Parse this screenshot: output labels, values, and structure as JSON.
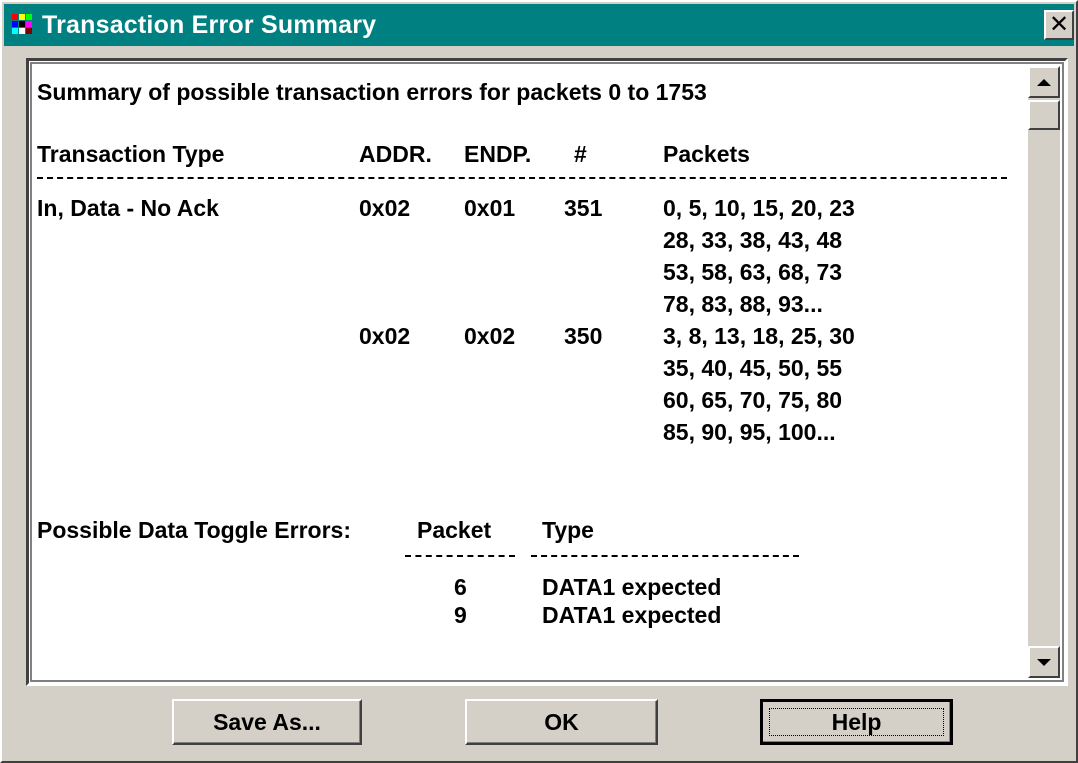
{
  "window": {
    "title": "Transaction Error Summary",
    "close_glyph": "✕"
  },
  "summary": {
    "heading": "Summary of possible transaction errors for packets 0 to 1753",
    "columns": {
      "type": "Transaction Type",
      "addr": "ADDR.",
      "endp": "ENDP.",
      "count": "#",
      "packets": "Packets"
    },
    "rows": [
      {
        "type": "In, Data - No Ack",
        "addr": "0x02",
        "endp": "0x01",
        "count": "351",
        "packets": [
          "0, 5, 10, 15, 20, 23",
          "28, 33, 38, 43, 48",
          "53, 58, 63, 68, 73",
          "78, 83, 88, 93..."
        ]
      },
      {
        "type": "",
        "addr": "0x02",
        "endp": "0x02",
        "count": "350",
        "packets": [
          "3, 8, 13, 18, 25, 30",
          "35, 40, 45, 50, 55",
          "60, 65, 70, 75, 80",
          "85, 90, 95, 100..."
        ]
      }
    ]
  },
  "toggle": {
    "label": "Possible Data Toggle Errors:",
    "col_packet": "Packet",
    "col_type": "Type",
    "rows": [
      {
        "packet": "6",
        "type": "DATA1 expected"
      },
      {
        "packet": "9",
        "type": "DATA1 expected"
      }
    ]
  },
  "buttons": {
    "save_as": "Save As...",
    "ok": "OK",
    "help": "Help"
  },
  "icons": {
    "scroll_up": "scroll-up-arrow-icon",
    "scroll_down": "scroll-down-arrow-icon"
  }
}
